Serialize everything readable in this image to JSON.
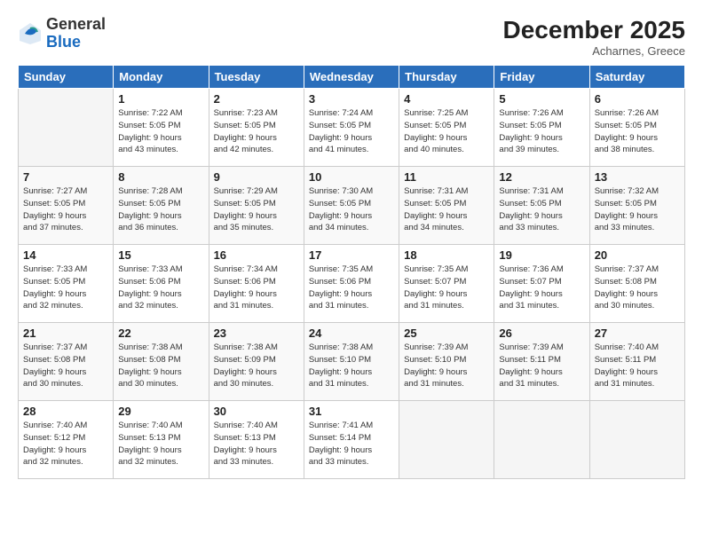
{
  "header": {
    "logo_general": "General",
    "logo_blue": "Blue",
    "month_title": "December 2025",
    "location": "Acharnes, Greece"
  },
  "weekdays": [
    "Sunday",
    "Monday",
    "Tuesday",
    "Wednesday",
    "Thursday",
    "Friday",
    "Saturday"
  ],
  "rows": [
    [
      {
        "day": "",
        "info": ""
      },
      {
        "day": "1",
        "info": "Sunrise: 7:22 AM\nSunset: 5:05 PM\nDaylight: 9 hours\nand 43 minutes."
      },
      {
        "day": "2",
        "info": "Sunrise: 7:23 AM\nSunset: 5:05 PM\nDaylight: 9 hours\nand 42 minutes."
      },
      {
        "day": "3",
        "info": "Sunrise: 7:24 AM\nSunset: 5:05 PM\nDaylight: 9 hours\nand 41 minutes."
      },
      {
        "day": "4",
        "info": "Sunrise: 7:25 AM\nSunset: 5:05 PM\nDaylight: 9 hours\nand 40 minutes."
      },
      {
        "day": "5",
        "info": "Sunrise: 7:26 AM\nSunset: 5:05 PM\nDaylight: 9 hours\nand 39 minutes."
      },
      {
        "day": "6",
        "info": "Sunrise: 7:26 AM\nSunset: 5:05 PM\nDaylight: 9 hours\nand 38 minutes."
      }
    ],
    [
      {
        "day": "7",
        "info": "Sunrise: 7:27 AM\nSunset: 5:05 PM\nDaylight: 9 hours\nand 37 minutes."
      },
      {
        "day": "8",
        "info": "Sunrise: 7:28 AM\nSunset: 5:05 PM\nDaylight: 9 hours\nand 36 minutes."
      },
      {
        "day": "9",
        "info": "Sunrise: 7:29 AM\nSunset: 5:05 PM\nDaylight: 9 hours\nand 35 minutes."
      },
      {
        "day": "10",
        "info": "Sunrise: 7:30 AM\nSunset: 5:05 PM\nDaylight: 9 hours\nand 34 minutes."
      },
      {
        "day": "11",
        "info": "Sunrise: 7:31 AM\nSunset: 5:05 PM\nDaylight: 9 hours\nand 34 minutes."
      },
      {
        "day": "12",
        "info": "Sunrise: 7:31 AM\nSunset: 5:05 PM\nDaylight: 9 hours\nand 33 minutes."
      },
      {
        "day": "13",
        "info": "Sunrise: 7:32 AM\nSunset: 5:05 PM\nDaylight: 9 hours\nand 33 minutes."
      }
    ],
    [
      {
        "day": "14",
        "info": "Sunrise: 7:33 AM\nSunset: 5:05 PM\nDaylight: 9 hours\nand 32 minutes."
      },
      {
        "day": "15",
        "info": "Sunrise: 7:33 AM\nSunset: 5:06 PM\nDaylight: 9 hours\nand 32 minutes."
      },
      {
        "day": "16",
        "info": "Sunrise: 7:34 AM\nSunset: 5:06 PM\nDaylight: 9 hours\nand 31 minutes."
      },
      {
        "day": "17",
        "info": "Sunrise: 7:35 AM\nSunset: 5:06 PM\nDaylight: 9 hours\nand 31 minutes."
      },
      {
        "day": "18",
        "info": "Sunrise: 7:35 AM\nSunset: 5:07 PM\nDaylight: 9 hours\nand 31 minutes."
      },
      {
        "day": "19",
        "info": "Sunrise: 7:36 AM\nSunset: 5:07 PM\nDaylight: 9 hours\nand 31 minutes."
      },
      {
        "day": "20",
        "info": "Sunrise: 7:37 AM\nSunset: 5:08 PM\nDaylight: 9 hours\nand 30 minutes."
      }
    ],
    [
      {
        "day": "21",
        "info": "Sunrise: 7:37 AM\nSunset: 5:08 PM\nDaylight: 9 hours\nand 30 minutes."
      },
      {
        "day": "22",
        "info": "Sunrise: 7:38 AM\nSunset: 5:08 PM\nDaylight: 9 hours\nand 30 minutes."
      },
      {
        "day": "23",
        "info": "Sunrise: 7:38 AM\nSunset: 5:09 PM\nDaylight: 9 hours\nand 30 minutes."
      },
      {
        "day": "24",
        "info": "Sunrise: 7:38 AM\nSunset: 5:10 PM\nDaylight: 9 hours\nand 31 minutes."
      },
      {
        "day": "25",
        "info": "Sunrise: 7:39 AM\nSunset: 5:10 PM\nDaylight: 9 hours\nand 31 minutes."
      },
      {
        "day": "26",
        "info": "Sunrise: 7:39 AM\nSunset: 5:11 PM\nDaylight: 9 hours\nand 31 minutes."
      },
      {
        "day": "27",
        "info": "Sunrise: 7:40 AM\nSunset: 5:11 PM\nDaylight: 9 hours\nand 31 minutes."
      }
    ],
    [
      {
        "day": "28",
        "info": "Sunrise: 7:40 AM\nSunset: 5:12 PM\nDaylight: 9 hours\nand 32 minutes."
      },
      {
        "day": "29",
        "info": "Sunrise: 7:40 AM\nSunset: 5:13 PM\nDaylight: 9 hours\nand 32 minutes."
      },
      {
        "day": "30",
        "info": "Sunrise: 7:40 AM\nSunset: 5:13 PM\nDaylight: 9 hours\nand 33 minutes."
      },
      {
        "day": "31",
        "info": "Sunrise: 7:41 AM\nSunset: 5:14 PM\nDaylight: 9 hours\nand 33 minutes."
      },
      {
        "day": "",
        "info": ""
      },
      {
        "day": "",
        "info": ""
      },
      {
        "day": "",
        "info": ""
      }
    ]
  ]
}
